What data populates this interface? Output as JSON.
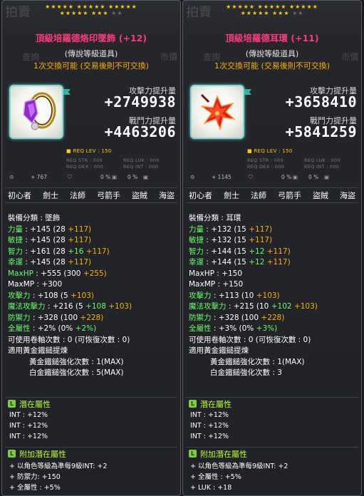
{
  "left": {
    "stars_row1": "★★★★★ ★★★★★ ★★★★★",
    "stars_row2": "★★★★★ ★★★",
    "stars_row2_dim": "★★",
    "title": "頂級培羅德烙印墜飾 (+12)",
    "subtitle": "(傳說等級道具)",
    "trade": "1次交換可能 (交易後則不可交換)",
    "attack_label": "攻擊力提升量",
    "attack_value": "+2749938",
    "power_label": "戰鬥力提升量",
    "power_value": "+4463206",
    "req_lev": "■ REQ LEV : 150",
    "req_str": "REQ STR : 000",
    "req_luk": "REQ LUK : 000",
    "req_dex": "REQ DEX : 000",
    "req_int": "REQ INT : 000",
    "mini": [
      "+ 767",
      "0 %",
      "0 %"
    ],
    "jobs": [
      "初心者",
      "劍士",
      "法師",
      "弓箭手",
      "盜賊",
      "海盜"
    ],
    "category": "裝備分類 : 墜飾",
    "stats": [
      {
        "k": "力量",
        "v": "+145",
        "base": "(28",
        "extra1": "+117)",
        "extra2": ""
      },
      {
        "k": "敏捷",
        "v": "+145",
        "base": "(28",
        "extra1": "+117)",
        "extra2": ""
      },
      {
        "k": "智力",
        "v": "+161",
        "base": "(28",
        "extra1": "+16",
        "extra2": "+117)"
      },
      {
        "k": "幸運",
        "v": "+145",
        "base": "(28",
        "extra1": "+117)",
        "extra2": ""
      }
    ],
    "maxhp": {
      "k": "MaxHP",
      "v": "+555",
      "base": "(300",
      "extra": "+255)"
    },
    "maxmp": {
      "k": "MaxMP",
      "v": "+300"
    },
    "atk": {
      "k": "攻擊力",
      "v": "+108",
      "base": "(5",
      "extra": "+103)"
    },
    "matk": {
      "k": "魔法攻擊力",
      "v": "+216",
      "base": "(5",
      "e1": "+108",
      "e2": "+103)"
    },
    "def": {
      "k": "防禦力",
      "v": "+328",
      "base": "(100",
      "extra": "+228)"
    },
    "allstat": {
      "k": "全屬性",
      "v": "+2%",
      "base": "(0%",
      "extra": "+2%)"
    },
    "upgrade": "可使用卷軸次數 : 0 (可恢復次數 : 0)",
    "hammer_title": "適用黃金鐵鎚提煉",
    "gold_hammer": "黃金鐵鎚強化次數 : 1(MAX)",
    "white_hammer": "白金鐵鎚強化次數 : 5(MAX)",
    "pot_title": "潛在屬性",
    "pot_lines": [
      "INT : +12%",
      "INT : +12%",
      "INT : +12%"
    ],
    "bonus_title": "附加潛在屬性",
    "bonus_lines": [
      "+ 以角色等級為準每9級INT: +2",
      "+ 防禦力: +150",
      "+ 全屬性 : +5%"
    ],
    "ghost": {
      "top": "拍賣",
      "search": "查詢",
      "market": "市價"
    }
  },
  "right": {
    "stars_row1": "★★★★★ ★★★★★ ★★★★★",
    "stars_row2": "★★★★★ ★★★",
    "stars_row2_dim": "★★",
    "title": "頂級培羅德耳環 (+11)",
    "subtitle": "(傳說等級道具)",
    "trade": "1次交換可能 (交易後則不可交換)",
    "attack_label": "攻擊力提升量",
    "attack_value": "+3658410",
    "power_label": "戰鬥力提升量",
    "power_value": "+5841259",
    "req_lev": "■ REQ LEV : 150",
    "req_str": "REQ STR : 000",
    "req_luk": "REQ LUK : 000",
    "req_dex": "REQ DEX : 000",
    "req_int": "REQ INT : 000",
    "mini": [
      "+ 1145",
      "0 %",
      "0 %"
    ],
    "jobs": [
      "初心者",
      "劍士",
      "法師",
      "弓箭手",
      "盜賊",
      "海盜"
    ],
    "category": "裝備分類 : 耳環",
    "stats": [
      {
        "k": "力量",
        "v": "+132",
        "base": "(15",
        "extra1": "+117)",
        "extra2": ""
      },
      {
        "k": "敏捷",
        "v": "+132",
        "base": "(15",
        "extra1": "+117)",
        "extra2": ""
      },
      {
        "k": "智力",
        "v": "+144",
        "base": "(15",
        "extra1": "+12",
        "extra2": "+117)"
      },
      {
        "k": "幸運",
        "v": "+144",
        "base": "(15",
        "extra1": "+12",
        "extra2": "+117)"
      }
    ],
    "maxhp": {
      "k": "MaxHP",
      "v": "+150"
    },
    "maxmp": {
      "k": "MaxMP",
      "v": "+150"
    },
    "atk": {
      "k": "攻擊力",
      "v": "+113",
      "base": "(10",
      "extra": "+103)"
    },
    "matk": {
      "k": "魔法攻擊力",
      "v": "+215",
      "base": "(10",
      "e1": "+102",
      "e2": "+103)"
    },
    "def": {
      "k": "防禦力",
      "v": "+328",
      "base": "(100",
      "extra": "+228)"
    },
    "allstat": {
      "k": "全屬性",
      "v": "+3%",
      "base": "(0%",
      "extra": "+3%)"
    },
    "upgrade": "可使用卷軸次數 : 0 (可恢復次數 : 0)",
    "hammer_title": "適用黃金鐵鎚提煉",
    "gold_hammer": "黃金鐵鎚強化次數 : 1(MAX)",
    "white_hammer": "白金鐵鎚強化次數 : 3",
    "pot_title": "潛在屬性",
    "pot_lines": [
      "INT : +12%",
      "INT : +12%",
      "INT : +12%"
    ],
    "bonus_title": "附加潛在屬性",
    "bonus_lines": [
      "+ 以角色等級為準每9級INT: +2",
      "+ 全屬性 : +5%",
      "+ LUK : +18"
    ],
    "ghost": {
      "top": "拍賣",
      "search": "查詢",
      "market": "市價"
    }
  }
}
